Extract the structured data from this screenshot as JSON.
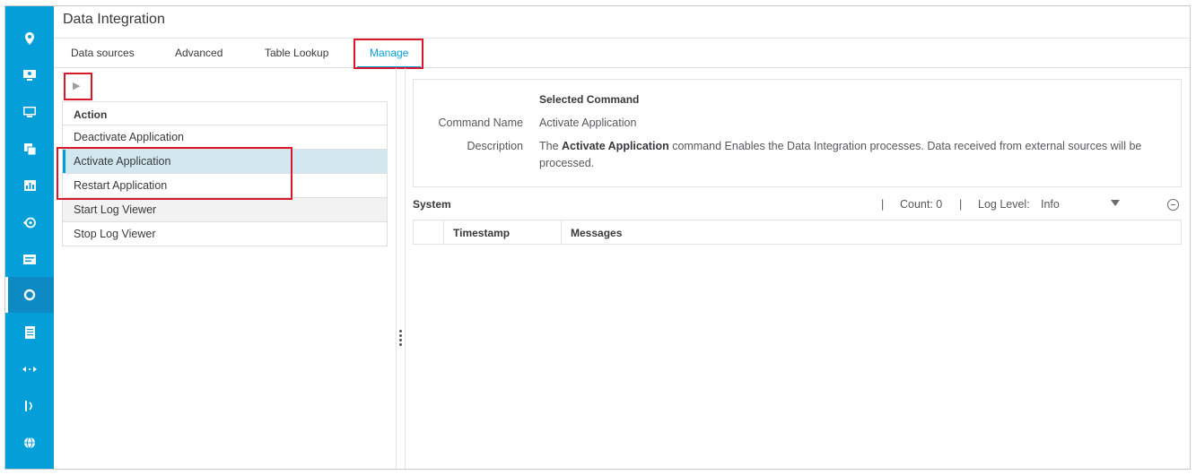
{
  "sidebar": {
    "icons": [
      "map-pin-icon",
      "monitor-person-icon",
      "display-icon",
      "copy-icon",
      "chart-icon",
      "history-icon",
      "list-card-icon",
      "data-integration-icon",
      "document-icon",
      "code-arrows-icon",
      "wireless-icon",
      "globe-icon"
    ],
    "active_index": 7,
    "color": "#049fd9"
  },
  "page": {
    "title": "Data Integration"
  },
  "tabs": [
    {
      "label": "Data sources"
    },
    {
      "label": "Advanced"
    },
    {
      "label": "Table Lookup"
    },
    {
      "label": "Manage",
      "active": true
    }
  ],
  "toolbar": {
    "run_icon": "play-icon",
    "run_glyph": "▶"
  },
  "actions": {
    "header": "Action",
    "items": [
      {
        "label": "Deactivate Application",
        "state": "normal"
      },
      {
        "label": "Activate Application",
        "state": "selected"
      },
      {
        "label": "Restart Application",
        "state": "normal"
      },
      {
        "label": "Start Log Viewer",
        "state": "disabled"
      },
      {
        "label": "Stop Log Viewer",
        "state": "normal"
      }
    ]
  },
  "selected_command": {
    "heading": "Selected Command",
    "name_label": "Command Name",
    "name_value": "Activate Application",
    "description_label": "Description",
    "description_prefix": "The ",
    "description_bold": "Activate Application",
    "description_suffix": " command Enables the Data Integration processes. Data received from external sources will be processed."
  },
  "system": {
    "title": "System",
    "separator": "|",
    "count_label": "Count: 0",
    "log_level_label": "Log Level:",
    "log_level_value": "Info"
  },
  "log_table": {
    "columns": [
      "Timestamp",
      "Messages"
    ]
  },
  "colors": {
    "accent": "#049fd9",
    "highlight": "#d8182a",
    "selected_row": "#d1e8f0"
  }
}
